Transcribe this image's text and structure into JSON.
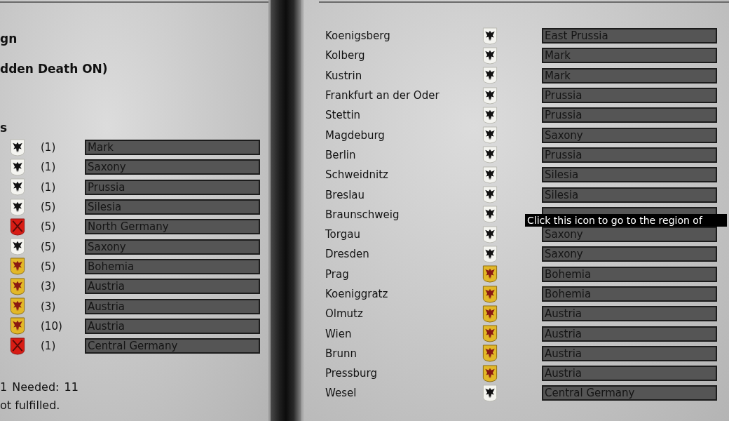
{
  "left_panel": {
    "title_fragment": "gn",
    "subtitle_fragment": "dden Death ON)",
    "section_fragment": "s",
    "objectives": [
      {
        "kind": "prussia",
        "count": "(1)",
        "region": "Mark"
      },
      {
        "kind": "prussia",
        "count": "(1)",
        "region": "Saxony"
      },
      {
        "kind": "prussia",
        "count": "(1)",
        "region": "Prussia"
      },
      {
        "kind": "prussia",
        "count": "(5)",
        "region": "Silesia"
      },
      {
        "kind": "red",
        "count": "(5)",
        "region": "North Germany"
      },
      {
        "kind": "prussia",
        "count": "(5)",
        "region": "Saxony"
      },
      {
        "kind": "austria",
        "count": "(5)",
        "region": "Bohemia"
      },
      {
        "kind": "austria",
        "count": "(3)",
        "region": "Austria"
      },
      {
        "kind": "austria",
        "count": "(3)",
        "region": "Austria"
      },
      {
        "kind": "austria",
        "count": "(10)",
        "region": "Austria"
      },
      {
        "kind": "red",
        "count": "(1)",
        "region": "Central Germany"
      }
    ],
    "score_line": "1  Needed: 11",
    "status_line": "ot fulfilled."
  },
  "right_panel": {
    "cities": [
      {
        "name": "Koenigsberg",
        "kind": "prussia",
        "region": "East Prussia"
      },
      {
        "name": "Kolberg",
        "kind": "prussia",
        "region": "Mark"
      },
      {
        "name": "Kustrin",
        "kind": "prussia",
        "region": "Mark"
      },
      {
        "name": "Frankfurt an der Oder",
        "kind": "prussia",
        "region": "Prussia"
      },
      {
        "name": "Stettin",
        "kind": "prussia",
        "region": "Prussia"
      },
      {
        "name": "Magdeburg",
        "kind": "prussia",
        "region": "Saxony"
      },
      {
        "name": "Berlin",
        "kind": "prussia",
        "region": "Prussia"
      },
      {
        "name": "Schweidnitz",
        "kind": "prussia",
        "region": "Silesia"
      },
      {
        "name": "Breslau",
        "kind": "prussia",
        "region": "Silesia"
      },
      {
        "name": "Braunschweig",
        "kind": "prussia"
      },
      {
        "name": "Torgau",
        "kind": "prussia",
        "region": "Saxony"
      },
      {
        "name": "Dresden",
        "kind": "prussia",
        "region": "Saxony"
      },
      {
        "name": "Prag",
        "kind": "austria",
        "region": "Bohemia"
      },
      {
        "name": "Koeniggratz",
        "kind": "austria",
        "region": "Bohemia"
      },
      {
        "name": "Olmutz",
        "kind": "austria",
        "region": "Austria"
      },
      {
        "name": "Wien",
        "kind": "austria",
        "region": "Austria"
      },
      {
        "name": "Brunn",
        "kind": "austria",
        "region": "Austria"
      },
      {
        "name": "Pressburg",
        "kind": "austria",
        "region": "Austria"
      },
      {
        "name": "Wesel",
        "kind": "prussia",
        "region": "Central Germany"
      }
    ]
  },
  "tooltip": {
    "text": "Click this icon to go to the region of"
  }
}
